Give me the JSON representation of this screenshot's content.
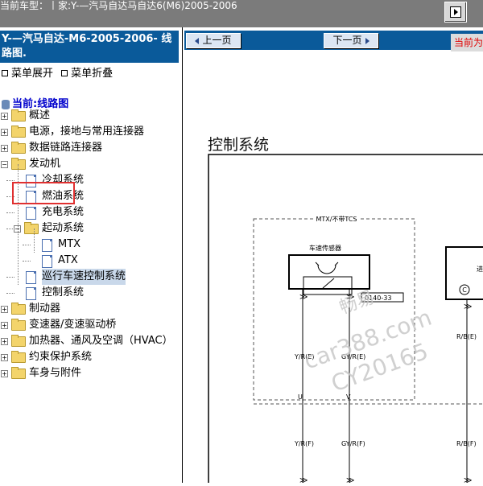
{
  "topbar": {
    "breadcrumb": "当前车型：丨家:Y-—汽马自达马自达6(M6)2005-2006"
  },
  "sidebar": {
    "header": "Y-—汽马自达-M6-2005-2006- 线路图.",
    "expand_label": "菜单展开",
    "collapse_label": "菜单折叠",
    "current_label": "当前:线路图",
    "tree": [
      {
        "label": "概述",
        "type": "folder",
        "level": 0,
        "toggle": "+"
      },
      {
        "label": "电源，接地与常用连接器",
        "type": "folder",
        "level": 0,
        "toggle": "+"
      },
      {
        "label": "数据链路连接器",
        "type": "folder",
        "level": 0,
        "toggle": "+"
      },
      {
        "label": "发动机",
        "type": "folder-open",
        "level": 0,
        "toggle": "-"
      },
      {
        "label": "冷却系统",
        "type": "doc",
        "level": 1
      },
      {
        "label": "燃油系统",
        "type": "doc",
        "level": 1
      },
      {
        "label": "充电系统",
        "type": "doc",
        "level": 1
      },
      {
        "label": "起动系统",
        "type": "folder-open",
        "level": 1,
        "toggle": "-"
      },
      {
        "label": "MTX",
        "type": "doc",
        "level": 2
      },
      {
        "label": "ATX",
        "type": "doc",
        "level": 2
      },
      {
        "label": "巡行车速控制系统",
        "type": "doc",
        "level": 1,
        "selected": true
      },
      {
        "label": "控制系统",
        "type": "doc",
        "level": 1
      },
      {
        "label": "制动器",
        "type": "folder",
        "level": 0,
        "toggle": "+"
      },
      {
        "label": "变速器/变速驱动桥",
        "type": "folder",
        "level": 0,
        "toggle": "+"
      },
      {
        "label": "加热器、通风及空调（HVAC）",
        "type": "folder",
        "level": 0,
        "toggle": "+"
      },
      {
        "label": "约束保护系统",
        "type": "folder",
        "level": 0,
        "toggle": "+"
      },
      {
        "label": "车身与附件",
        "type": "folder",
        "level": 0,
        "toggle": "+"
      }
    ]
  },
  "content": {
    "prev_label": "上一页",
    "next_label": "下一页",
    "current_page_label": "当前为",
    "diagram": {
      "title": "控制系统",
      "section_label": "MTX/不带TCS",
      "sensor_label": "车速传感器",
      "right_label": "进",
      "connector_code": "0140-33",
      "wire_top_left": "Y/R(E)",
      "wire_top_mid": "GY/R(E)",
      "wire_top_right": "R/B(E)",
      "wire_bot_left": "Y/R(F)",
      "wire_bot_mid": "GY/R(F)",
      "wire_bot_right": "R/B(F)",
      "conn_letter_left": "U",
      "conn_letter_mid": "V",
      "circle_letter": "C",
      "watermark_1": "畅易",
      "watermark_2": "car388.com",
      "watermark_3": "CY20165"
    }
  },
  "colors": {
    "accent_blue": "#0a5a9a",
    "highlight_red": "#e03030",
    "selected_bg": "#c9d8ea"
  }
}
